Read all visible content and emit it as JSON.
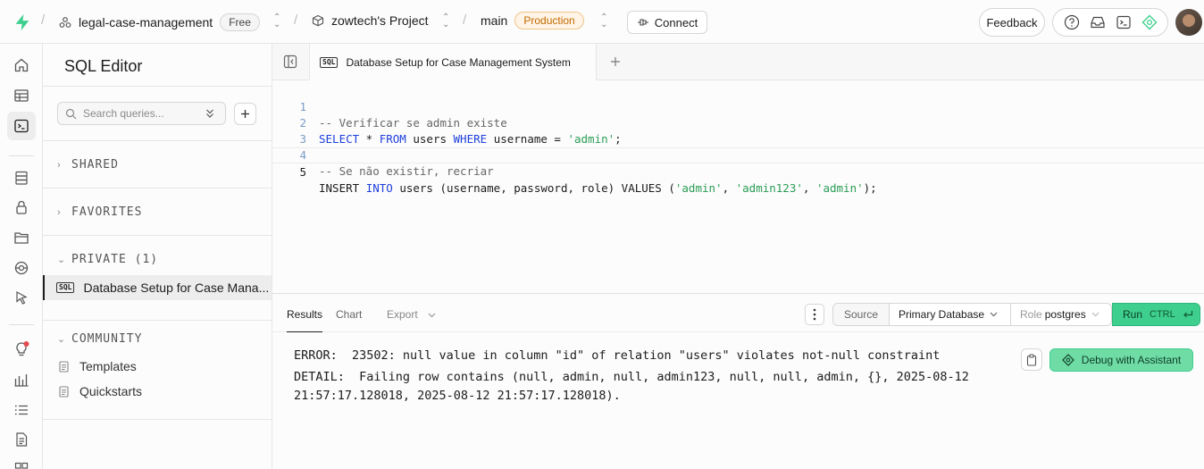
{
  "topbar": {
    "org_name": "legal-case-management",
    "plan_badge": "Free",
    "project_name": "zowtech's Project",
    "branch_name": "main",
    "env_badge": "Production",
    "connect_label": "Connect",
    "feedback_label": "Feedback"
  },
  "sidebar": {
    "title": "SQL Editor",
    "search_placeholder": "Search queries...",
    "sections": {
      "shared": "SHARED",
      "favorites": "FAVORITES",
      "private": "PRIVATE (1)",
      "community": "COMMUNITY"
    },
    "private_snippet": "Database Setup for Case Mana...",
    "community_items": [
      "Templates",
      "Quickstarts"
    ]
  },
  "editor": {
    "tab_title": "Database Setup for Case Management System",
    "sql_tag": "SQL",
    "line_numbers": [
      "1",
      "2",
      "3",
      "4",
      "5"
    ]
  },
  "results": {
    "tabs": [
      "Results",
      "Chart",
      "Export"
    ],
    "source_label": "Source",
    "database_label": "Primary Database",
    "role_label": "Role",
    "role_value": "postgres",
    "run_label": "Run",
    "run_shortcut": "CTRL",
    "error_line1": "ERROR:  23502: null value in column \"id\" of relation \"users\" violates not-null constraint",
    "error_line2": "DETAIL:  Failing row contains (null, admin, null, admin123, null, null, admin, {}, 2025-08-12",
    "error_line3": "21:57:17.128018, 2025-08-12 21:57:17.128018).",
    "debug_label": "Debug with Assistant"
  },
  "colors": {
    "accent": "#3ecf8e",
    "production_badge": "#c26a00",
    "sql_keyword": "#1f3fdc",
    "sql_string": "#2a9d55"
  }
}
